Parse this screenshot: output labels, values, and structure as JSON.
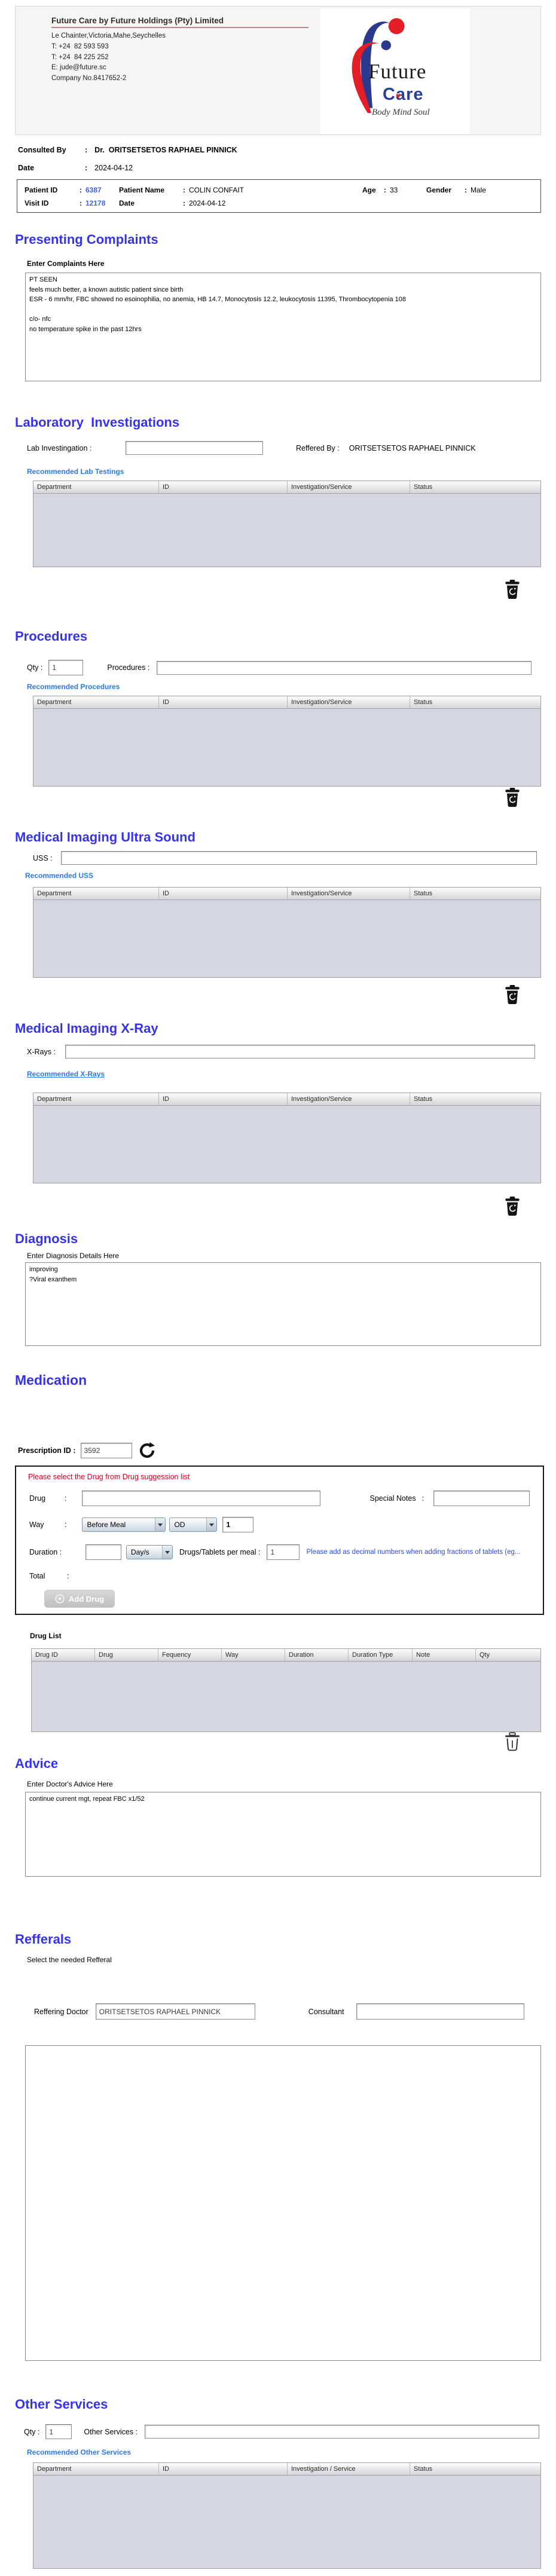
{
  "ui": {
    "colon": ":"
  },
  "icons": {
    "heart": "♥"
  },
  "colors": {
    "heading_blue": "#3533f0",
    "link_blue": "#2979f2",
    "id_blue": "#4064d8",
    "warning_red": "#cc0022",
    "note_blue": "#2b4fe0",
    "table_body_grey": "#d4d7e1",
    "logo_blue": "#2b3a8f",
    "logo_red": "#e31e26"
  },
  "header": {
    "company_name": "Future Care by Future Holdings (Pty) Limited",
    "address": "Le Chainter,Victoria,Mahe,Seychelles",
    "phone1": "T: +24  82 593 593",
    "phone2": "T: +24  84 225 252",
    "email": "E: jude@future.sc",
    "company_no": "Company No.8417652-2",
    "logo": {
      "brand_top": "Future",
      "brand_bottom": "Care",
      "tagline": "Body Mind Soul"
    }
  },
  "consulted": {
    "label": "Consulted By",
    "value": "Dr.  ORITSETSETOS RAPHAEL PINNICK"
  },
  "visit_date": {
    "label": "Date",
    "value": "2024-04-12"
  },
  "patient": {
    "id_label": "Patient ID",
    "id": "6387",
    "name_label": "Patient Name",
    "name": "COLIN CONFAIT",
    "age_label": "Age",
    "age": "33",
    "gender_label": "Gender",
    "gender": "Male",
    "visit_label": "Visit ID",
    "visit_id": "12178",
    "date_label": "Date",
    "date": "2024-04-12"
  },
  "complaints": {
    "title": "Presenting Complaints",
    "sub": "Enter Complaints Here",
    "text": "PT SEEN\nfeels much better, a known autistic patient since birth\nESR - 6 mm/hr, FBC showed no esoinophilia, no anemia, HB 14.7, Monocytosis 12.2, leukocytosis 11395, Thrombocytopenia 108\n\nc/o- nfc\nno temperature spike in the past 12hrs"
  },
  "lab": {
    "title": "Laboratory  Investigations",
    "field_label": "Lab Investingation :",
    "referred_label": "Reffered By :",
    "referred_value": "ORITSETSETOS RAPHAEL PINNICK",
    "link": "Recommended Lab Testings",
    "headers": [
      "Department",
      "ID",
      "Investigation/Service",
      "Status"
    ]
  },
  "procedures": {
    "title": "Procedures",
    "qty_label": "Qty :",
    "qty": "1",
    "field_label": "Procedures :",
    "link": "Recommended Procedures",
    "headers": [
      "Department",
      "ID",
      "Investigation/Service",
      "Status"
    ]
  },
  "uss": {
    "title": "Medical Imaging Ultra Sound",
    "field_label": "USS :",
    "link": "Recommended USS",
    "headers": [
      "Department",
      "ID",
      "Investigation/Service",
      "Status"
    ]
  },
  "xray": {
    "title": "Medical Imaging X-Ray",
    "field_label": "X-Rays :",
    "link": "Recommended X-Rays",
    "headers": [
      "Department",
      "ID",
      "Investigation/Service",
      "Status"
    ]
  },
  "diagnosis": {
    "title": "Diagnosis",
    "sub": "Enter Diagnosis Details Here",
    "text": "improving\n?Viral exanthem"
  },
  "medication": {
    "title": "Medication",
    "rx_label": "Prescription ID :",
    "rx_id": "3592",
    "warning": "Please select the Drug from Drug suggession list",
    "drug_label": "Drug",
    "special_label": "Special Notes",
    "way_label": "Way",
    "way_value": "Before Meal",
    "freq_value": "OD",
    "dose": "1",
    "duration_label": "Duration :",
    "duration_type": "Day/s",
    "per_meal_label": "Drugs/Tablets per meal :",
    "per_meal": "1",
    "note": "Please add as decimal numbers when adding fractions of tablets (eg...",
    "total_label": "Total",
    "add_button": "Add Drug",
    "list_label": "Drug List",
    "headers": [
      "Drug ID",
      "Drug",
      "Fequency",
      "Way",
      "Duration",
      "Duration Type",
      "Note",
      "Qty"
    ]
  },
  "advice": {
    "title": "Advice",
    "sub": "Enter Doctor's Advice Here",
    "text": "continue current mgt, repeat FBC x1/52"
  },
  "referrals": {
    "title": "Refferals",
    "sub": "Select the needed Refferal",
    "doctor_label": "Reffering Doctor",
    "doctor": "ORITSETSETOS RAPHAEL PINNICK",
    "consultant_label": "Consultant"
  },
  "other": {
    "title": "Other Services",
    "qty_label": "Qty :",
    "qty": "1",
    "field_label": "Other Services :",
    "link": "Recommended Other Services",
    "headers": [
      "Department",
      "ID",
      "Investigation / Service",
      "Status"
    ]
  }
}
